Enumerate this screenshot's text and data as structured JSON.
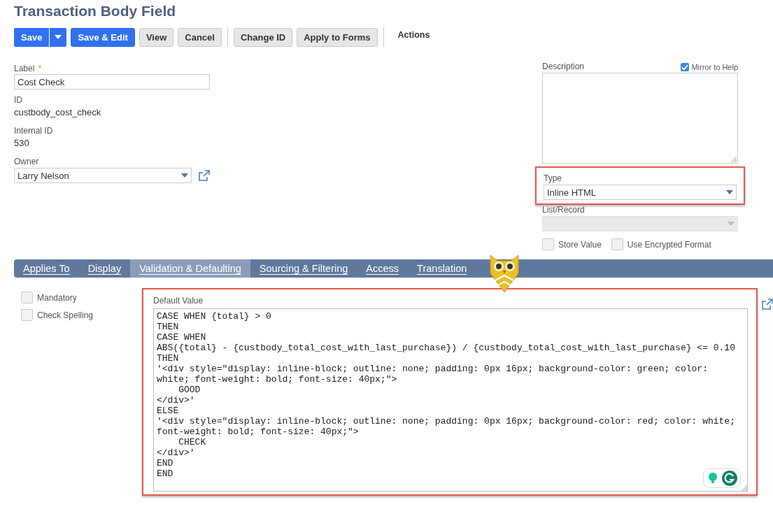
{
  "title": "Transaction Body Field",
  "toolbar": [
    {
      "label": "Save",
      "kind": "primary-split"
    },
    {
      "label": "Save & Edit",
      "kind": "primary"
    },
    {
      "label": "View",
      "kind": "secondary"
    },
    {
      "label": "Cancel",
      "kind": "secondary"
    },
    {
      "kind": "divider"
    },
    {
      "label": "Change ID",
      "kind": "secondary"
    },
    {
      "label": "Apply to Forms",
      "kind": "secondary"
    },
    {
      "kind": "divider"
    },
    {
      "label": "Actions",
      "kind": "menu"
    }
  ],
  "fields": [
    {
      "label": "Label",
      "required_mark": "*",
      "kind": "input",
      "value": "Cost Check"
    },
    {
      "label": "ID",
      "kind": "text",
      "value": "custbody_cost_check"
    },
    {
      "label": "Internal ID",
      "kind": "text",
      "value": "530"
    },
    {
      "label": "Owner",
      "kind": "select",
      "value": "Larry Nelson"
    }
  ],
  "description": {
    "label": "Description",
    "mirror_label": "Mirror to Help",
    "mirror_checked": true
  },
  "type": {
    "label": "Type",
    "value": "Inline HTML",
    "highlighted": true
  },
  "list_record": {
    "label": "List/Record",
    "disabled": true
  },
  "options": [
    {
      "label": "Store Value",
      "checked": false
    },
    {
      "label": "Use Encrypted Format",
      "checked": false
    }
  ],
  "tabs": [
    {
      "label": "Applies To",
      "selected": false
    },
    {
      "label": "Display",
      "selected": false
    },
    {
      "label": "Validation & Defaulting",
      "selected": true
    },
    {
      "label": "Sourcing & Filtering",
      "selected": false
    },
    {
      "label": "Access",
      "selected": false
    },
    {
      "label": "Translation",
      "selected": false
    }
  ],
  "validation": [
    {
      "label": "Mandatory",
      "checked": false
    },
    {
      "label": "Check Spelling",
      "checked": false
    }
  ],
  "default_value": {
    "label": "Default Value",
    "highlighted": true,
    "value": "CASE WHEN {total} > 0\nTHEN\nCASE WHEN\nABS({total} - {custbody_total_cost_with_last_purchase}) / {custbody_total_cost_with_last_purchase} <= 0.10\nTHEN\n'<div style=\"display: inline-block; outline: none; padding: 0px 16px; background-color: green; color: white; font-weight: bold; font-size: 40px;\">\n    GOOD\n</div>'\nELSE\n'<div style=\"display: inline-block; outline: none; padding: 0px 16px; background-color: red; color: white; font-weight: bold; font-size: 40px;\">\n    CHECK\n</div>'\nEND\nEND"
  }
}
